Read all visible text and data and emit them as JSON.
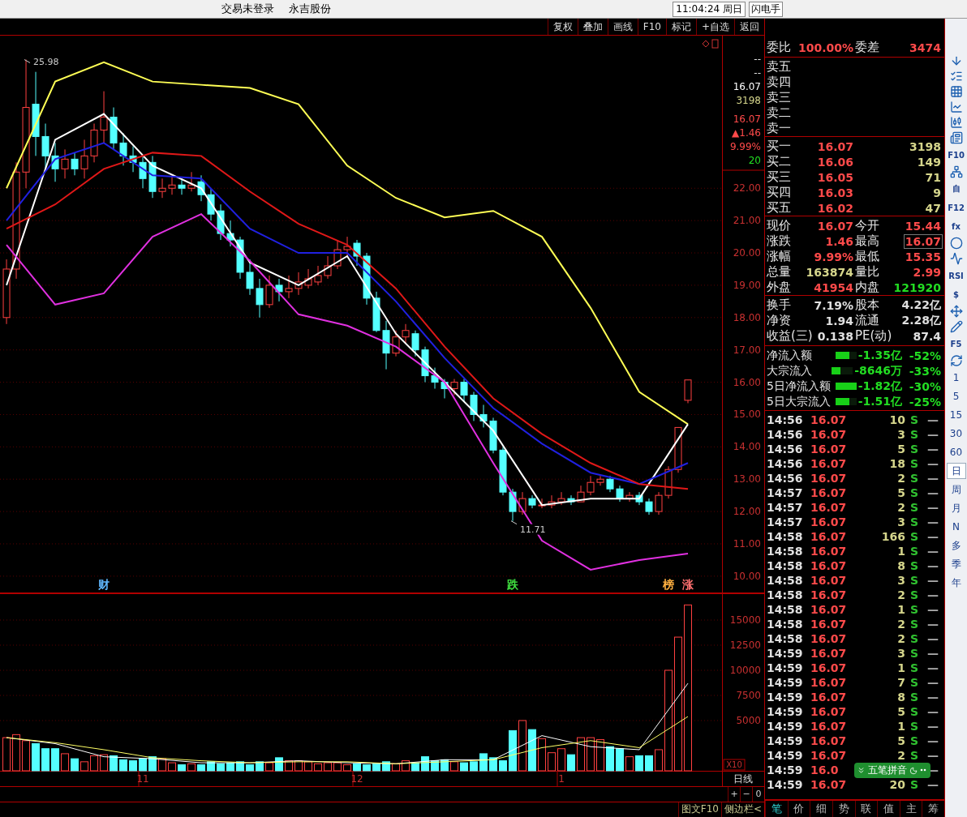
{
  "title_bar": {
    "status": "交易未登录",
    "stock": "永吉股份",
    "clock": "11:04:24 周日",
    "shortcut": "闪电手"
  },
  "toolbar": [
    "复权",
    "叠加",
    "画线",
    "F10",
    "标记",
    "+自选",
    "返回"
  ],
  "price_chart": {
    "chart_data": {
      "type": "line",
      "grid": true,
      "ylim": [
        9.47,
        26.72
      ],
      "categories": [
        null,
        null,
        null,
        null,
        null,
        null,
        null,
        null,
        null,
        null,
        null,
        null,
        null,
        null,
        null,
        null,
        null,
        null,
        null,
        null,
        null,
        null,
        null,
        null,
        null,
        null,
        null,
        null,
        null,
        null,
        null,
        null,
        null,
        null,
        null,
        null,
        null,
        null,
        null,
        null,
        null,
        null,
        null,
        null,
        null,
        null,
        null,
        null,
        null,
        null,
        null,
        null,
        null,
        null,
        null,
        null,
        null,
        null,
        null,
        null,
        null,
        null,
        null,
        null,
        null,
        null,
        null,
        null,
        null,
        null,
        null
      ],
      "yticks": [
        {
          "value": 10,
          "label": "10.00"
        },
        {
          "value": 11,
          "label": "11.00"
        },
        {
          "value": 12,
          "label": "12.00"
        },
        {
          "value": 13,
          "label": "13.00"
        },
        {
          "value": 14,
          "label": "14.00"
        },
        {
          "value": 15,
          "label": "15.00"
        },
        {
          "value": 16,
          "label": "16.00"
        },
        {
          "value": 17,
          "label": "17.00"
        },
        {
          "value": 18,
          "label": "18.00"
        },
        {
          "value": 19,
          "label": "19.00"
        },
        {
          "value": 20,
          "label": "20.00"
        },
        {
          "value": 21,
          "label": "21.00"
        },
        {
          "value": 22,
          "label": "22.00"
        }
      ],
      "series": [
        {
          "type": "candlestick",
          "colors": [
            "#ff4040",
            "#ff4040",
            "#ff4040",
            "#54ffff",
            "#54ffff",
            "#54ffff",
            "#ff4040",
            "#54ffff",
            "#ff4040",
            "#ff4040",
            "#ff4040",
            "#54ffff",
            "#54ffff",
            "#54ffff",
            "#54ffff",
            "#54ffff",
            "#ff4040",
            "#ff4040",
            "#54ffff",
            "#ff4040",
            "#54ffff",
            "#54ffff",
            "#54ffff",
            "#54ffff",
            "#54ffff",
            "#54ffff",
            "#54ffff",
            "#ff4040",
            "#54ffff",
            "#ff4040",
            "#ff4040",
            "#ff4040",
            "#ff4040",
            "#ff4040",
            "#ff4040",
            "#ff4040",
            "#54ffff",
            "#54ffff",
            "#54ffff",
            "#54ffff",
            "#ff4040",
            "#ff4040",
            "#54ffff",
            "#54ffff",
            "#54ffff",
            "#54ffff",
            "#ff4040",
            "#54ffff",
            "#54ffff",
            "#54ffff",
            "#54ffff",
            "#54ffff",
            "#54ffff",
            "#ff4040",
            "#54ffff",
            "#ff4040",
            "#ff4040",
            "#ff4040",
            "#54ffff",
            "#ff4040",
            "#ff4040",
            "#ff4040",
            "#54ffff",
            "#54ffff",
            "#ff4040",
            "#54ffff",
            "#54ffff",
            "#ff4040",
            "#ff4040",
            "#ff4040",
            "#ff4040"
          ],
          "ohlc": [
            [
              18.0,
              19.8,
              17.8,
              19.5
            ],
            [
              19.5,
              22.8,
              19.2,
              22.5
            ],
            [
              22.5,
              25.98,
              22.0,
              24.5
            ],
            [
              24.6,
              25.6,
              23.0,
              23.6
            ],
            [
              23.6,
              24.0,
              22.6,
              23.0
            ],
            [
              23.0,
              23.4,
              22.2,
              22.6
            ],
            [
              22.6,
              23.2,
              22.3,
              22.9
            ],
            [
              22.9,
              23.1,
              22.4,
              22.6
            ],
            [
              22.6,
              23.5,
              22.3,
              23.0
            ],
            [
              23.0,
              24.0,
              22.8,
              23.8
            ],
            [
              23.8,
              25.0,
              23.4,
              24.2
            ],
            [
              24.2,
              24.5,
              23.2,
              23.4
            ],
            [
              23.4,
              23.7,
              22.7,
              23.0
            ],
            [
              23.0,
              23.3,
              22.5,
              22.8
            ],
            [
              22.8,
              23.0,
              22.0,
              22.3
            ],
            [
              22.8,
              23.0,
              21.7,
              21.9
            ],
            [
              21.9,
              22.3,
              21.7,
              22.0
            ],
            [
              22.0,
              22.4,
              21.8,
              22.1
            ],
            [
              22.1,
              22.3,
              21.8,
              22.0
            ],
            [
              22.0,
              22.5,
              21.9,
              22.1
            ],
            [
              22.2,
              22.4,
              21.6,
              21.8
            ],
            [
              21.8,
              22.0,
              21.0,
              21.2
            ],
            [
              21.3,
              21.5,
              20.4,
              20.6
            ],
            [
              20.6,
              21.0,
              20.2,
              20.4
            ],
            [
              20.4,
              20.5,
              19.2,
              19.4
            ],
            [
              19.4,
              19.8,
              18.7,
              18.9
            ],
            [
              18.9,
              19.2,
              18.0,
              18.4
            ],
            [
              18.4,
              19.3,
              18.3,
              19.0
            ],
            [
              19.0,
              19.2,
              18.5,
              18.8
            ],
            [
              18.8,
              19.3,
              18.6,
              18.9
            ],
            [
              18.9,
              19.4,
              18.7,
              19.1
            ],
            [
              19.0,
              19.5,
              18.9,
              19.2
            ],
            [
              19.1,
              19.6,
              19.0,
              19.3
            ],
            [
              19.3,
              19.9,
              19.2,
              19.6
            ],
            [
              19.6,
              20.4,
              19.5,
              20.1
            ],
            [
              20.1,
              20.5,
              19.9,
              20.2
            ],
            [
              20.3,
              20.4,
              19.6,
              19.9
            ],
            [
              19.9,
              20.0,
              18.4,
              18.6
            ],
            [
              18.6,
              18.8,
              17.55,
              17.6
            ],
            [
              17.6,
              17.9,
              16.4,
              16.9
            ],
            [
              16.9,
              17.6,
              16.8,
              17.4
            ],
            [
              17.4,
              17.8,
              17.2,
              17.6
            ],
            [
              17.5,
              17.6,
              16.8,
              17.0
            ],
            [
              17.0,
              17.1,
              16.0,
              16.2
            ],
            [
              16.2,
              16.45,
              15.8,
              16.0
            ],
            [
              16.0,
              16.1,
              15.5,
              15.8
            ],
            [
              15.8,
              16.1,
              15.6,
              16.0
            ],
            [
              16.0,
              16.1,
              15.4,
              15.6
            ],
            [
              15.6,
              15.7,
              14.8,
              15.0
            ],
            [
              15.0,
              15.3,
              14.6,
              14.8
            ],
            [
              14.8,
              14.9,
              13.8,
              13.9
            ],
            [
              13.9,
              14.0,
              12.5,
              12.6
            ],
            [
              12.6,
              12.7,
              11.71,
              12.0
            ],
            [
              12.0,
              12.6,
              11.9,
              12.4
            ],
            [
              12.4,
              12.5,
              12.1,
              12.2
            ],
            [
              12.2,
              12.4,
              12.1,
              12.2
            ],
            [
              12.2,
              12.5,
              12.1,
              12.3
            ],
            [
              12.3,
              12.6,
              12.2,
              12.4
            ],
            [
              12.4,
              12.5,
              12.2,
              12.3
            ],
            [
              12.3,
              12.8,
              12.3,
              12.6
            ],
            [
              12.6,
              13.1,
              12.5,
              12.9
            ],
            [
              12.9,
              13.1,
              12.8,
              13.0
            ],
            [
              13.0,
              13.1,
              12.6,
              12.7
            ],
            [
              12.7,
              12.8,
              12.3,
              12.4
            ],
            [
              12.4,
              12.6,
              12.3,
              12.5
            ],
            [
              12.5,
              12.6,
              12.2,
              12.3
            ],
            [
              12.3,
              12.4,
              11.9,
              12.0
            ],
            [
              12.0,
              12.6,
              11.9,
              12.5
            ],
            [
              12.5,
              13.4,
              12.4,
              13.3
            ],
            [
              13.3,
              14.6,
              13.2,
              14.6
            ],
            [
              15.44,
              16.07,
              15.35,
              16.07
            ]
          ]
        },
        {
          "type": "line",
          "color": "#ffff55",
          "values": [
            22.0,
            null,
            null,
            null,
            null,
            25.3,
            null,
            null,
            null,
            null,
            25.9,
            null,
            null,
            null,
            null,
            25.3,
            null,
            null,
            null,
            null,
            25.2,
            null,
            null,
            null,
            null,
            25.1,
            null,
            null,
            null,
            null,
            24.6,
            null,
            null,
            null,
            null,
            22.7,
            null,
            null,
            null,
            null,
            21.7,
            null,
            null,
            null,
            null,
            21.1,
            null,
            null,
            null,
            null,
            21.3,
            null,
            null,
            null,
            null,
            20.5,
            null,
            null,
            null,
            null,
            18.3,
            null,
            null,
            null,
            null,
            15.7,
            null,
            null,
            null,
            null,
            14.7
          ]
        },
        {
          "type": "line",
          "color": "#ffffff",
          "values": [
            19.0,
            null,
            null,
            null,
            null,
            23.5,
            null,
            null,
            null,
            null,
            24.3,
            null,
            null,
            null,
            null,
            22.7,
            null,
            null,
            null,
            null,
            22.0,
            null,
            null,
            null,
            null,
            19.7,
            null,
            null,
            null,
            null,
            19.0,
            null,
            null,
            null,
            null,
            19.9,
            null,
            null,
            null,
            null,
            17.5,
            null,
            null,
            null,
            null,
            16.0,
            null,
            null,
            null,
            null,
            14.5,
            null,
            null,
            null,
            null,
            12.2,
            null,
            null,
            null,
            null,
            12.4,
            null,
            null,
            null,
            null,
            12.4,
            null,
            null,
            null,
            null,
            14.7
          ]
        },
        {
          "type": "line",
          "color": "#2020e0",
          "values": [
            21.0,
            null,
            null,
            null,
            null,
            22.9,
            null,
            null,
            null,
            null,
            23.4,
            null,
            null,
            null,
            null,
            22.4,
            null,
            null,
            null,
            null,
            22.3,
            null,
            null,
            null,
            null,
            20.75,
            null,
            null,
            null,
            null,
            20.0,
            null,
            null,
            null,
            null,
            20.0,
            null,
            null,
            null,
            null,
            18.5,
            null,
            null,
            null,
            null,
            16.75,
            null,
            null,
            null,
            null,
            15.2,
            null,
            null,
            null,
            null,
            14.1,
            null,
            null,
            null,
            null,
            13.2,
            null,
            null,
            null,
            null,
            12.85,
            null,
            null,
            null,
            null,
            13.5
          ]
        },
        {
          "type": "line",
          "color": "#e01818",
          "values": [
            20.75,
            null,
            null,
            null,
            null,
            21.5,
            null,
            null,
            null,
            null,
            22.6,
            null,
            null,
            null,
            null,
            23.1,
            null,
            null,
            null,
            null,
            23.0,
            null,
            null,
            null,
            null,
            21.9,
            null,
            null,
            null,
            null,
            20.9,
            null,
            null,
            null,
            null,
            20.25,
            null,
            null,
            null,
            null,
            18.9,
            null,
            null,
            null,
            null,
            17.1,
            null,
            null,
            null,
            null,
            15.5,
            null,
            null,
            null,
            null,
            14.4,
            null,
            null,
            null,
            null,
            13.5,
            null,
            null,
            null,
            null,
            12.85,
            null,
            null,
            null,
            null,
            12.7
          ]
        },
        {
          "type": "line",
          "color": "#e030e0",
          "values": [
            20.25,
            null,
            null,
            null,
            null,
            18.4,
            null,
            null,
            null,
            null,
            18.75,
            null,
            null,
            null,
            null,
            20.5,
            null,
            null,
            null,
            null,
            21.2,
            null,
            null,
            null,
            null,
            19.75,
            null,
            null,
            null,
            null,
            18.1,
            null,
            null,
            null,
            null,
            17.75,
            null,
            null,
            null,
            null,
            17.1,
            null,
            null,
            null,
            null,
            16.0,
            null,
            null,
            null,
            null,
            13.5,
            null,
            null,
            null,
            null,
            11.1,
            null,
            null,
            null,
            null,
            10.2,
            null,
            null,
            null,
            null,
            10.5,
            null,
            null,
            null,
            null,
            10.7
          ]
        }
      ],
      "annotations": [
        {
          "text": "25.98"
        },
        {
          "text": "11.71"
        }
      ]
    },
    "markers": [
      {
        "text": "财",
        "color": "#60b8ff"
      },
      {
        "text": "跌",
        "color": "#40e040"
      },
      {
        "text": "榜",
        "color": "#ffb040"
      },
      {
        "text": "涨",
        "color": "#ff7070"
      }
    ],
    "quote_column": [
      {
        "text": "--",
        "kind": "plain"
      },
      {
        "text": "--",
        "kind": "plain"
      },
      {
        "text": "16.07",
        "kind": "bright"
      },
      {
        "text": "3198",
        "kind": "volume"
      },
      {
        "text": "16.07",
        "kind": "rise"
      },
      {
        "text": "▲1.46",
        "kind": "rise"
      },
      {
        "text": "9.99%",
        "kind": "rise"
      },
      {
        "text": "20",
        "kind": "fall"
      }
    ]
  },
  "volume_chart": {
    "chart_data": {
      "type": "bar",
      "grid": true,
      "ylim": [
        0,
        17660
      ],
      "yticks": [
        5000,
        7500,
        10000,
        12500,
        15000
      ],
      "categories": [
        null,
        null,
        null,
        null,
        null,
        null,
        null,
        null,
        null,
        null,
        null,
        null,
        null,
        null,
        "11",
        null,
        null,
        null,
        null,
        null,
        null,
        null,
        null,
        null,
        null,
        null,
        null,
        null,
        null,
        null,
        null,
        null,
        null,
        null,
        null,
        null,
        "12",
        null,
        null,
        null,
        null,
        null,
        null,
        null,
        null,
        null,
        null,
        null,
        null,
        null,
        null,
        null,
        null,
        null,
        null,
        null,
        null,
        "1",
        null,
        null,
        null,
        null,
        null,
        null,
        null,
        null,
        null,
        null,
        null,
        null,
        null
      ],
      "series": [
        {
          "type": "bar",
          "colors": [
            "#ff4040",
            "#ff4040",
            "#ff4040",
            "#54ffff",
            "#54ffff",
            "#54ffff",
            "#ff4040",
            "#54ffff",
            "#ff4040",
            "#ff4040",
            "#ff4040",
            "#54ffff",
            "#54ffff",
            "#54ffff",
            "#54ffff",
            "#54ffff",
            "#ff4040",
            "#ff4040",
            "#54ffff",
            "#ff4040",
            "#54ffff",
            "#54ffff",
            "#54ffff",
            "#54ffff",
            "#54ffff",
            "#54ffff",
            "#54ffff",
            "#ff4040",
            "#54ffff",
            "#ff4040",
            "#ff4040",
            "#ff4040",
            "#ff4040",
            "#ff4040",
            "#ff4040",
            "#ff4040",
            "#54ffff",
            "#54ffff",
            "#54ffff",
            "#54ffff",
            "#ff4040",
            "#ff4040",
            "#54ffff",
            "#54ffff",
            "#54ffff",
            "#54ffff",
            "#ff4040",
            "#54ffff",
            "#54ffff",
            "#54ffff",
            "#54ffff",
            "#54ffff",
            "#54ffff",
            "#ff4040",
            "#54ffff",
            "#ff4040",
            "#ff4040",
            "#ff4040",
            "#54ffff",
            "#ff4040",
            "#ff4040",
            "#ff4040",
            "#54ffff",
            "#54ffff",
            "#ff4040",
            "#54ffff",
            "#54ffff",
            "#ff4040",
            "#ff4040",
            "#ff4040",
            "#ff4040"
          ],
          "values": [
            3300,
            3600,
            3000,
            2700,
            2200,
            2200,
            1700,
            1200,
            900,
            1500,
            1600,
            1500,
            1100,
            1000,
            1200,
            1400,
            1200,
            800,
            600,
            700,
            600,
            900,
            700,
            800,
            900,
            600,
            900,
            800,
            1300,
            1000,
            1000,
            900,
            700,
            800,
            800,
            600,
            700,
            600,
            700,
            900,
            700,
            1000,
            800,
            1400,
            1000,
            1100,
            900,
            800,
            900,
            1700,
            1300,
            1000,
            4000,
            5000,
            4100,
            3200,
            1800,
            2200,
            1600,
            3300,
            3300,
            3100,
            2400,
            2200,
            1400,
            1500,
            1500,
            2100,
            10000,
            13300,
            16500
          ]
        },
        {
          "type": "line",
          "color": "#ffffff",
          "values": [
            3300,
            null,
            null,
            null,
            null,
            2700,
            null,
            null,
            null,
            null,
            1400,
            null,
            null,
            null,
            null,
            1200,
            null,
            null,
            null,
            null,
            800,
            null,
            null,
            null,
            null,
            800,
            null,
            null,
            null,
            null,
            1000,
            null,
            null,
            null,
            null,
            800,
            null,
            null,
            null,
            null,
            700,
            null,
            null,
            null,
            null,
            1100,
            null,
            null,
            null,
            null,
            1100,
            null,
            null,
            null,
            null,
            3500,
            null,
            null,
            null,
            null,
            2400,
            null,
            null,
            null,
            null,
            2100,
            null,
            null,
            null,
            null,
            8700
          ]
        },
        {
          "type": "line",
          "color": "#ffff66",
          "values": [
            3300,
            null,
            null,
            null,
            null,
            2800,
            null,
            null,
            null,
            null,
            2100,
            null,
            null,
            null,
            null,
            1300,
            null,
            null,
            null,
            null,
            1000,
            null,
            null,
            null,
            null,
            800,
            null,
            null,
            null,
            null,
            900,
            null,
            null,
            null,
            null,
            900,
            null,
            null,
            null,
            null,
            700,
            null,
            null,
            null,
            null,
            900,
            null,
            null,
            null,
            null,
            1100,
            null,
            null,
            null,
            null,
            2300,
            null,
            null,
            null,
            null,
            3000,
            null,
            null,
            null,
            null,
            2300,
            null,
            null,
            null,
            null,
            5400
          ]
        }
      ]
    },
    "unit": "X10"
  },
  "period_label": "日线",
  "zoom_buttons": [
    "+",
    "−",
    "0"
  ],
  "bottom_links": [
    "图文F10",
    "侧边栏<"
  ],
  "order_book": {
    "ratio": {
      "label": "委比",
      "value": "100.00%",
      "label2": "委差",
      "value2": "3474"
    },
    "asks": [
      {
        "label": "卖五"
      },
      {
        "label": "卖四"
      },
      {
        "label": "卖三"
      },
      {
        "label": "卖二"
      },
      {
        "label": "卖一"
      }
    ],
    "bids": [
      {
        "label": "买一",
        "price": "16.07",
        "volume": "3198"
      },
      {
        "label": "买二",
        "price": "16.06",
        "volume": "149"
      },
      {
        "label": "买三",
        "price": "16.05",
        "volume": "71"
      },
      {
        "label": "买四",
        "price": "16.03",
        "volume": "9"
      },
      {
        "label": "买五",
        "price": "16.02",
        "volume": "47"
      }
    ]
  },
  "quote_stats": [
    {
      "left": {
        "label": "现价",
        "value": "16.07",
        "color": "#ff4a4a"
      },
      "right": {
        "label": "今开",
        "value": "15.44",
        "color": "#ff4a4a",
        "boxed": false
      }
    },
    {
      "left": {
        "label": "涨跌",
        "value": "1.46",
        "color": "#ff4a4a"
      },
      "right": {
        "label": "最高",
        "value": "16.07",
        "color": "#ff4a4a",
        "boxed": true
      }
    },
    {
      "left": {
        "label": "涨幅",
        "value": "9.99%",
        "color": "#ff4a4a"
      },
      "right": {
        "label": "最低",
        "value": "15.35",
        "color": "#ff4a4a",
        "boxed": false
      }
    },
    {
      "left": {
        "label": "总量",
        "value": "163874",
        "color": "#d6d68c"
      },
      "right": {
        "label": "量比",
        "value": "2.99",
        "color": "#ff4a4a",
        "boxed": false
      }
    },
    {
      "left": {
        "label": "外盘",
        "value": "41954",
        "color": "#ff4a4a"
      },
      "right": {
        "label": "内盘",
        "value": "121920",
        "color": "#22dd22",
        "boxed": false
      }
    }
  ],
  "fundamentals": [
    {
      "label": "换手",
      "value": "7.19%",
      "label2": "股本",
      "value2": "4.22亿"
    },
    {
      "label": "净资",
      "value": "1.94",
      "label2": "流通",
      "value2": "2.28亿"
    },
    {
      "label": "收益(三)",
      "value": "0.138",
      "label2": "PE(动)",
      "value2": "87.4"
    }
  ],
  "fund_flow": [
    {
      "label": "净流入额",
      "level": 0.65,
      "value": "-1.35亿",
      "percent": "-52%"
    },
    {
      "label": "大宗流入",
      "level": 0.4,
      "value": "-8646万",
      "percent": "-33%"
    },
    {
      "label": "5日净流入额",
      "level": 1.0,
      "value": "-1.82亿",
      "percent": "-30%"
    },
    {
      "label": "5日大宗流入",
      "level": 0.65,
      "value": "-1.51亿",
      "percent": "-25%"
    }
  ],
  "trades": [
    {
      "time": "14:56",
      "price": "16.07",
      "volume": "10",
      "side": "S",
      "mark": "—"
    },
    {
      "time": "14:56",
      "price": "16.07",
      "volume": "3",
      "side": "S",
      "mark": "—"
    },
    {
      "time": "14:56",
      "price": "16.07",
      "volume": "5",
      "side": "S",
      "mark": "—"
    },
    {
      "time": "14:56",
      "price": "16.07",
      "volume": "18",
      "side": "S",
      "mark": "—"
    },
    {
      "time": "14:56",
      "price": "16.07",
      "volume": "2",
      "side": "S",
      "mark": "—"
    },
    {
      "time": "14:57",
      "price": "16.07",
      "volume": "5",
      "side": "S",
      "mark": "—"
    },
    {
      "time": "14:57",
      "price": "16.07",
      "volume": "2",
      "side": "S",
      "mark": "—"
    },
    {
      "time": "14:57",
      "price": "16.07",
      "volume": "3",
      "side": "S",
      "mark": "—"
    },
    {
      "time": "14:58",
      "price": "16.07",
      "volume": "166",
      "side": "S",
      "mark": "—"
    },
    {
      "time": "14:58",
      "price": "16.07",
      "volume": "1",
      "side": "S",
      "mark": "—"
    },
    {
      "time": "14:58",
      "price": "16.07",
      "volume": "8",
      "side": "S",
      "mark": "—"
    },
    {
      "time": "14:58",
      "price": "16.07",
      "volume": "3",
      "side": "S",
      "mark": "—"
    },
    {
      "time": "14:58",
      "price": "16.07",
      "volume": "2",
      "side": "S",
      "mark": "—"
    },
    {
      "time": "14:58",
      "price": "16.07",
      "volume": "1",
      "side": "S",
      "mark": "—"
    },
    {
      "time": "14:58",
      "price": "16.07",
      "volume": "2",
      "side": "S",
      "mark": "—"
    },
    {
      "time": "14:58",
      "price": "16.07",
      "volume": "2",
      "side": "S",
      "mark": "—"
    },
    {
      "time": "14:59",
      "price": "16.07",
      "volume": "3",
      "side": "S",
      "mark": "—"
    },
    {
      "time": "14:59",
      "price": "16.07",
      "volume": "1",
      "side": "S",
      "mark": "—"
    },
    {
      "time": "14:59",
      "price": "16.07",
      "volume": "7",
      "side": "S",
      "mark": "—"
    },
    {
      "time": "14:59",
      "price": "16.07",
      "volume": "8",
      "side": "S",
      "mark": "—"
    },
    {
      "time": "14:59",
      "price": "16.07",
      "volume": "5",
      "side": "S",
      "mark": "—"
    },
    {
      "time": "14:59",
      "price": "16.07",
      "volume": "1",
      "side": "S",
      "mark": "—"
    },
    {
      "time": "14:59",
      "price": "16.07",
      "volume": "5",
      "side": "S",
      "mark": "—"
    },
    {
      "time": "14:59",
      "price": "16.07",
      "volume": "2",
      "side": "S",
      "mark": "—"
    },
    {
      "time": "14:59",
      "price": "16.0",
      "mark": "—"
    },
    {
      "time": "14:59",
      "price": "16.07",
      "volume": "20",
      "side": "S",
      "mark": "—"
    }
  ],
  "ime_bar": {
    "label": "五笔拼音"
  },
  "panel_tabs": [
    {
      "label": "笔",
      "selected": true
    },
    {
      "label": "价",
      "selected": false
    },
    {
      "label": "细",
      "selected": false
    },
    {
      "label": "势",
      "selected": false
    },
    {
      "label": "联",
      "selected": false
    },
    {
      "label": "值",
      "selected": false
    },
    {
      "label": "主",
      "selected": false
    },
    {
      "label": "筹",
      "selected": false
    }
  ],
  "tools": [
    {
      "kind": "arrow"
    },
    {
      "kind": "list"
    },
    {
      "kind": "grid"
    },
    {
      "kind": "line"
    },
    {
      "kind": "candles"
    },
    {
      "kind": "cards"
    },
    {
      "kind": "text",
      "text": "F10"
    },
    {
      "kind": "tree"
    },
    {
      "kind": "text",
      "text": "自"
    },
    {
      "kind": "text",
      "text": "F12"
    },
    {
      "kind": "text",
      "text": "fx"
    },
    {
      "kind": "circle"
    },
    {
      "kind": "wave"
    },
    {
      "kind": "text",
      "text": "RSI"
    },
    {
      "kind": "text",
      "text": "$"
    },
    {
      "kind": "move"
    },
    {
      "kind": "pencil"
    },
    {
      "kind": "text",
      "text": "F5"
    },
    {
      "kind": "refresh"
    }
  ],
  "periods": [
    {
      "label": "1",
      "selected": false
    },
    {
      "label": "5",
      "selected": false
    },
    {
      "label": "15",
      "selected": false
    },
    {
      "label": "30",
      "selected": false
    },
    {
      "label": "60",
      "selected": false
    },
    {
      "label": "日",
      "selected": true
    },
    {
      "label": "周",
      "selected": false
    },
    {
      "label": "月",
      "selected": false
    },
    {
      "label": "N",
      "selected": false
    },
    {
      "label": "多",
      "selected": false
    },
    {
      "label": "季",
      "selected": false
    },
    {
      "label": "年",
      "selected": false
    }
  ]
}
